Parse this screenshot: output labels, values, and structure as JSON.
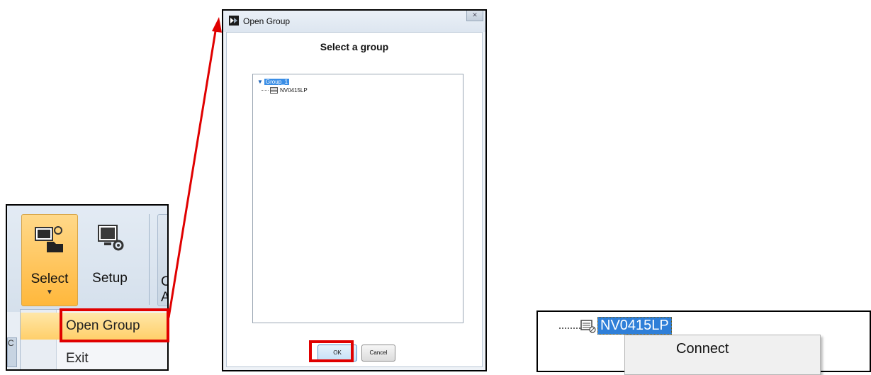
{
  "ribbon": {
    "buttons": [
      {
        "label": "Select",
        "icon": "monitor-folder-icon"
      },
      {
        "label": "Setup",
        "icon": "monitor-gear-icon"
      }
    ],
    "partial_button_lines": [
      "C",
      "A"
    ],
    "menu": {
      "items": [
        {
          "label": "Open Group"
        },
        {
          "label": "Exit"
        }
      ]
    },
    "left_tab_glyph": "C"
  },
  "dialog": {
    "title": "Open Group",
    "close_glyph": "✕",
    "heading": "Select a group",
    "tree": {
      "root": {
        "label": "Group_1",
        "expanded": true
      },
      "children": [
        {
          "label": "NV0415LP"
        }
      ]
    },
    "buttons": {
      "ok": "OK",
      "cancel": "Cancel"
    }
  },
  "context": {
    "node_label": "NV0415LP",
    "menu": {
      "items": [
        {
          "label": "Connect"
        }
      ]
    }
  },
  "colors": {
    "annotation_red": "#e00000",
    "selection_blue": "#2f7fd8",
    "ribbon_highlight": "#ffc45a"
  }
}
